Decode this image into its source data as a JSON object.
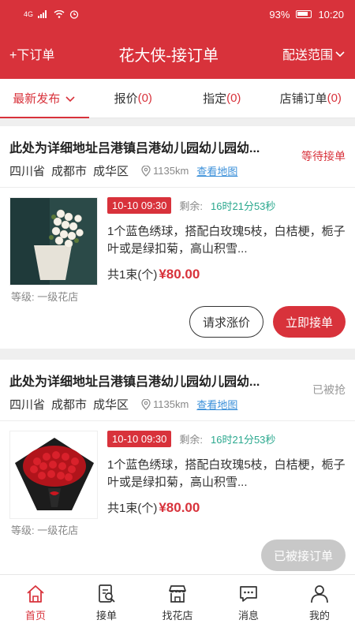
{
  "statusbar": {
    "signal": "4G",
    "battery": "93%",
    "time": "10:20"
  },
  "topbar": {
    "left": "+下订单",
    "title": "花大侠-接订单",
    "right": "配送范围"
  },
  "tabs": [
    {
      "label": "最新发布",
      "count": ""
    },
    {
      "label": "报价",
      "count": "(0)"
    },
    {
      "label": "指定",
      "count": "(0)"
    },
    {
      "label": "店铺订单",
      "count": "(0)"
    }
  ],
  "orders": [
    {
      "address": "此处为详细地址吕港镇吕港幼儿园幼儿园幼...",
      "status": "等待接单",
      "province": "四川省",
      "city": "成都市",
      "district": "成华区",
      "distance": "1135km",
      "map_link": "查看地图",
      "time": "10-10 09:30",
      "remain_label": "剩余:",
      "remain": "16时21分53秒",
      "desc": "1个蓝色绣球，搭配白玫瑰5枝，白桔梗，栀子叶或是绿扣菊，高山积雪...",
      "qty": "共1束(个)",
      "price": "¥80.00",
      "grade": "等级:  一级花店",
      "btn_secondary": "请求涨价",
      "btn_primary": "立即接单"
    },
    {
      "address": "此处为详细地址吕港镇吕港幼儿园幼儿园幼...",
      "status": "已被抢",
      "province": "四川省",
      "city": "成都市",
      "district": "成华区",
      "distance": "1135km",
      "map_link": "查看地图",
      "time": "10-10 09:30",
      "remain_label": "剩余:",
      "remain": "16时21分53秒",
      "desc": "1个蓝色绣球，搭配白玫瑰5枝，白桔梗，栀子叶或是绿扣菊，高山积雪...",
      "qty": "共1束(个)",
      "price": "¥80.00",
      "grade": "等级:  一级花店",
      "btn_disabled": "已被接订单"
    }
  ],
  "bottomnav": [
    {
      "label": "首页",
      "icon": "home-icon"
    },
    {
      "label": "接单",
      "icon": "order-search-icon"
    },
    {
      "label": "找花店",
      "icon": "store-icon"
    },
    {
      "label": "消息",
      "icon": "message-icon"
    },
    {
      "label": "我的",
      "icon": "user-icon"
    }
  ],
  "colors": {
    "accent": "#d8323b",
    "remain": "#2aa88e",
    "link": "#3a8fd9"
  }
}
